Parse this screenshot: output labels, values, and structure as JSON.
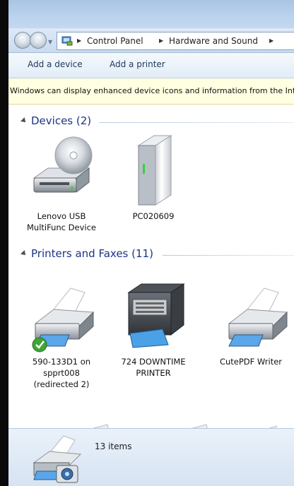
{
  "address_bar": {
    "segments": [
      "Control Panel",
      "Hardware and Sound"
    ]
  },
  "toolbar": {
    "add_device": "Add a device",
    "add_printer": "Add a printer"
  },
  "info_bar": {
    "text": "Windows can display enhanced device icons and information from the Internet. Click to change..."
  },
  "groups": {
    "devices": {
      "title": "Devices (2)",
      "items": [
        {
          "label_line1": "Lenovo USB",
          "label_line2": "MultiFunc Device",
          "icon": "cd-drive-icon"
        },
        {
          "label_line1": "PC020609",
          "icon": "computer-tower-icon"
        }
      ]
    },
    "printers": {
      "title": "Printers and Faxes (11)",
      "items": [
        {
          "label_line1": "590-133D1 on",
          "label_line2": "spprt008",
          "label_line3": "(redirected 2)",
          "icon": "printer-icon",
          "default": true
        },
        {
          "label_line1": "724 DOWNTIME",
          "label_line2": "PRINTER",
          "icon": "multifunction-printer-icon"
        },
        {
          "label_line1": "CutePDF Writer",
          "icon": "printer-icon"
        }
      ]
    }
  },
  "status_bar": {
    "count": "13 items",
    "icon": "printer-camera-icon"
  }
}
